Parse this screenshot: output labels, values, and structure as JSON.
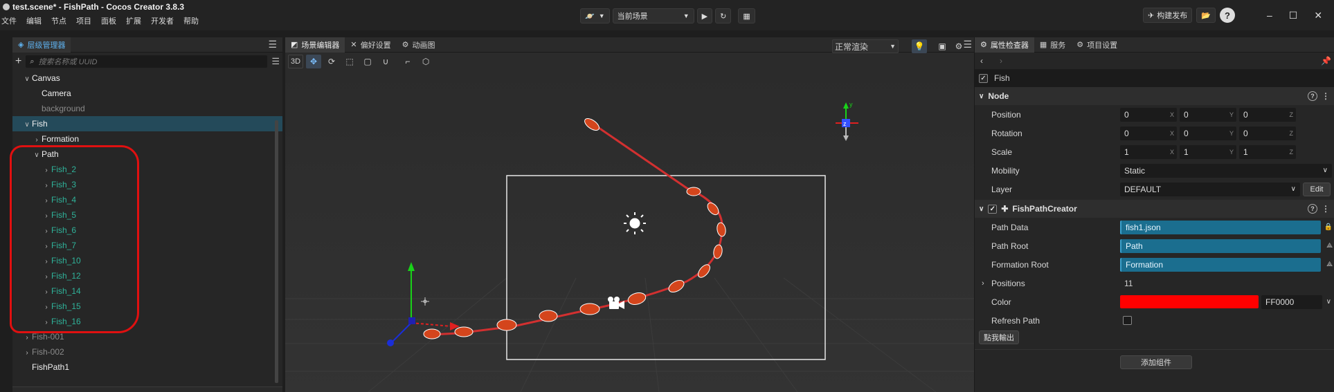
{
  "window": {
    "title": "test.scene* - FishPath - Cocos Creator 3.8.3",
    "menu": [
      "文件",
      "编辑",
      "节点",
      "项目",
      "面板",
      "扩展",
      "开发者",
      "帮助"
    ],
    "scene_select": "当前场景",
    "build_button": "构建发布",
    "controls": [
      "–",
      "☐",
      "✕"
    ]
  },
  "hierarchy": {
    "tab_label": "层级管理器",
    "search_placeholder": "搜索名称或 UUID",
    "nodes": [
      {
        "label": "Canvas",
        "depth": 1,
        "arrow": "∨",
        "style": "bright"
      },
      {
        "label": "Camera",
        "depth": 2,
        "arrow": "",
        "style": "bright"
      },
      {
        "label": "background",
        "depth": 2,
        "arrow": "",
        "style": "dim"
      },
      {
        "label": "Fish",
        "depth": 1,
        "arrow": "∨",
        "style": "bright",
        "selected": true
      },
      {
        "label": "Formation",
        "depth": 2,
        "arrow": "›",
        "style": "bright"
      },
      {
        "label": "Path",
        "depth": 2,
        "arrow": "∨",
        "style": "bright"
      },
      {
        "label": "Fish_2",
        "depth": 3,
        "arrow": "›",
        "style": "teal"
      },
      {
        "label": "Fish_3",
        "depth": 3,
        "arrow": "›",
        "style": "teal"
      },
      {
        "label": "Fish_4",
        "depth": 3,
        "arrow": "›",
        "style": "teal"
      },
      {
        "label": "Fish_5",
        "depth": 3,
        "arrow": "›",
        "style": "teal"
      },
      {
        "label": "Fish_6",
        "depth": 3,
        "arrow": "›",
        "style": "teal"
      },
      {
        "label": "Fish_7",
        "depth": 3,
        "arrow": "›",
        "style": "teal"
      },
      {
        "label": "Fish_10",
        "depth": 3,
        "arrow": "›",
        "style": "teal"
      },
      {
        "label": "Fish_12",
        "depth": 3,
        "arrow": "›",
        "style": "teal"
      },
      {
        "label": "Fish_14",
        "depth": 3,
        "arrow": "›",
        "style": "teal"
      },
      {
        "label": "Fish_15",
        "depth": 3,
        "arrow": "›",
        "style": "teal"
      },
      {
        "label": "Fish_16",
        "depth": 3,
        "arrow": "›",
        "style": "teal"
      },
      {
        "label": "Fish-001",
        "depth": 1,
        "arrow": "›",
        "style": "dim"
      },
      {
        "label": "Fish-002",
        "depth": 1,
        "arrow": "›",
        "style": "dim"
      },
      {
        "label": "FishPath1",
        "depth": 1,
        "arrow": "",
        "style": "bright"
      }
    ]
  },
  "scene": {
    "tabs": [
      "场景编辑器",
      "偏好设置",
      "动画图"
    ],
    "mode_3d": "3D",
    "render_mode": "正常渲染",
    "gizmo_axes": {
      "y": "y",
      "z": "z"
    }
  },
  "inspector": {
    "tabs": [
      "属性检查器",
      "服务",
      "项目设置"
    ],
    "node_name": "Fish",
    "node_section": "Node",
    "position": {
      "label": "Position",
      "x": "0",
      "y": "0",
      "z": "0"
    },
    "rotation": {
      "label": "Rotation",
      "x": "0",
      "y": "0",
      "z": "0"
    },
    "scale": {
      "label": "Scale",
      "x": "1",
      "y": "1",
      "z": "1"
    },
    "mobility": {
      "label": "Mobility",
      "value": "Static"
    },
    "layer": {
      "label": "Layer",
      "value": "DEFAULT",
      "edit": "Edit"
    },
    "component": {
      "name": "FishPathCreator",
      "path_data": {
        "label": "Path Data",
        "value": "fish1.json"
      },
      "path_root": {
        "label": "Path Root",
        "value": "Path"
      },
      "formation_root": {
        "label": "Formation Root",
        "value": "Formation"
      },
      "positions": {
        "label": "Positions",
        "value": "11"
      },
      "color": {
        "label": "Color",
        "hex": "FF0000",
        "swatch": "#ff0000"
      },
      "refresh_path": {
        "label": "Refresh Path"
      }
    },
    "export_button": "點我輸出",
    "add_component": "添加组件"
  },
  "axis_letters": {
    "x": "X",
    "y": "Y",
    "z": "Z"
  }
}
